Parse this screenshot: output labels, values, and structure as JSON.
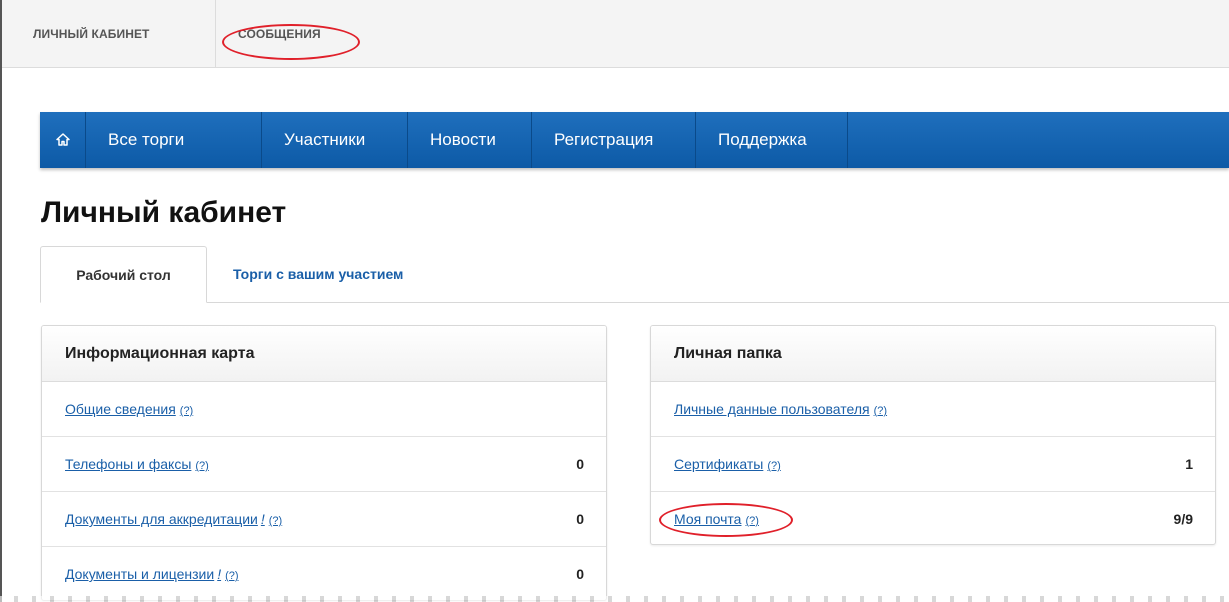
{
  "topbar": {
    "cabinet_label": "ЛИЧНЫЙ КАБИНЕТ",
    "messages_label": "СООБЩЕНИЯ"
  },
  "nav": {
    "home_icon": "home-icon",
    "items": [
      "Все торги",
      "Участники",
      "Новости",
      "Регистрация",
      "Поддержка"
    ]
  },
  "page": {
    "title": "Личный кабинет"
  },
  "tabs": {
    "active": "Рабочий стол",
    "inactive": "Торги с вашим участием"
  },
  "info_card": {
    "title": "Информационная карта",
    "rows": [
      {
        "label": "Общие сведения",
        "help": "(?)",
        "bang": "",
        "value": ""
      },
      {
        "label": "Телефоны и факсы",
        "help": "(?)",
        "bang": "",
        "value": "0"
      },
      {
        "label": "Документы для аккредитации",
        "help": "(?)",
        "bang": "!",
        "value": "0"
      },
      {
        "label": "Документы и лицензии",
        "help": "(?)",
        "bang": "!",
        "value": "0"
      }
    ]
  },
  "personal_folder": {
    "title": "Личная папка",
    "rows": [
      {
        "label": "Личные данные пользователя",
        "help": "(?)",
        "value": ""
      },
      {
        "label": "Сертификаты",
        "help": "(?)",
        "value": "1"
      },
      {
        "label": "Моя почта",
        "help": "(?)",
        "value": "9/9"
      }
    ]
  },
  "colors": {
    "nav_blue": "#1565b5",
    "link_blue": "#1a5fa8",
    "highlight_red": "#e0202a"
  }
}
